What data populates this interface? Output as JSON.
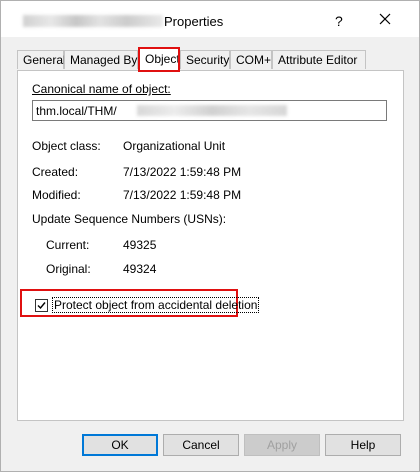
{
  "window": {
    "title": "Properties",
    "help_glyph": "?"
  },
  "tabs": [
    {
      "label": "General"
    },
    {
      "label": "Managed By"
    },
    {
      "label": "Object"
    },
    {
      "label": "Security"
    },
    {
      "label": "COM+"
    },
    {
      "label": "Attribute Editor"
    }
  ],
  "object": {
    "canonical_label": "Canonical name of object:",
    "canonical_value": "thm.local/THM/",
    "class_label": "Object class:",
    "class_value": "Organizational Unit",
    "created_label": "Created:",
    "created_value": "7/13/2022 1:59:48 PM",
    "modified_label": "Modified:",
    "modified_value": "7/13/2022 1:59:48 PM",
    "usn_label": "Update Sequence Numbers (USNs):",
    "current_label": "Current:",
    "current_value": "49325",
    "original_label": "Original:",
    "original_value": "49324",
    "protect_label": "Protect object from accidental deletion",
    "protect_checked": true
  },
  "buttons": {
    "ok": "OK",
    "cancel": "Cancel",
    "apply": "Apply",
    "help": "Help"
  },
  "colors": {
    "highlight": "#e01010",
    "default_button_border": "#0078d7"
  }
}
